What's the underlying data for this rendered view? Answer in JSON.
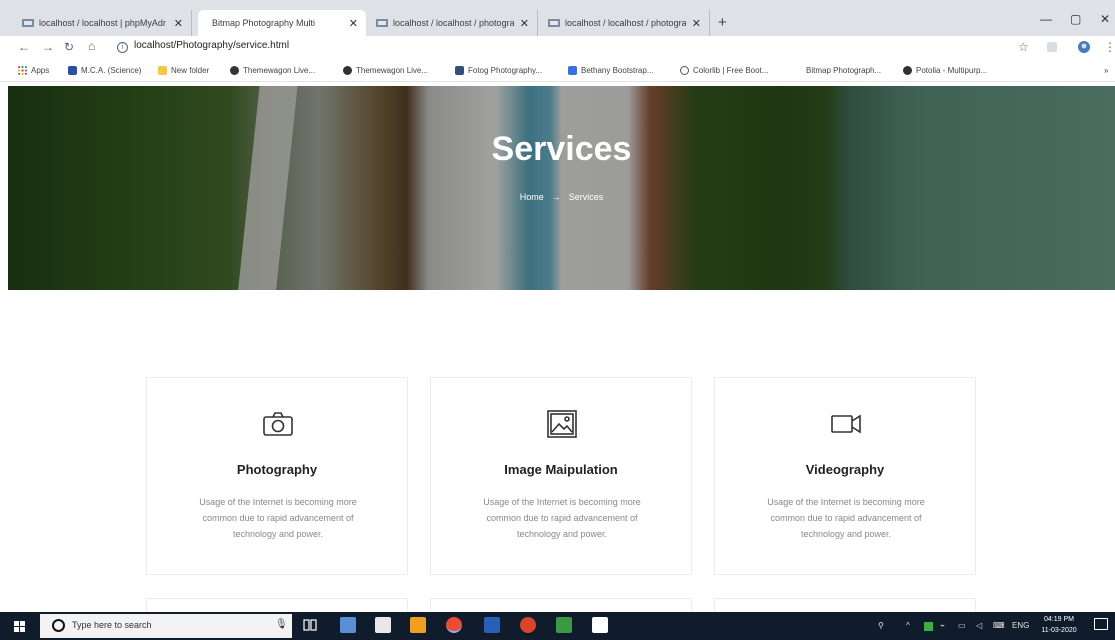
{
  "browser": {
    "tabs": [
      {
        "label": "localhost / localhost | phpMyAdr",
        "active": false
      },
      {
        "label": "Bitmap Photography Multi",
        "active": true
      },
      {
        "label": "localhost / localhost / photogra",
        "active": false
      },
      {
        "label": "localhost / localhost / photogra",
        "active": false
      }
    ],
    "new_tab_label": "+",
    "url": "localhost/Photography/service.html",
    "bookmarks": [
      "Apps",
      "M.C.A. (Science)",
      "New folder",
      "Themewagon Live...",
      "Themewagon Live...",
      "Fotog Photography...",
      "Bethany Bootstrap...",
      "Colorlib | Free Boot...",
      "Bitmap Photograph...",
      "Potolia - Multipurp..."
    ]
  },
  "hero": {
    "title": "Services",
    "breadcrumb": {
      "home": "Home",
      "separator": "→",
      "current": "Services"
    }
  },
  "services": [
    {
      "icon": "camera-icon",
      "title": "Photography",
      "description": "Usage of the Internet is becoming more common due to rapid advancement of technology and power."
    },
    {
      "icon": "image-icon",
      "title": "Image Maipulation",
      "description": "Usage of the Internet is becoming more common due to rapid advancement of technology and power."
    },
    {
      "icon": "video-camera-icon",
      "title": "Videography",
      "description": "Usage of the Internet is becoming more common due to rapid advancement of technology and power."
    }
  ],
  "taskbar": {
    "search_placeholder": "Type here to search",
    "language": "ENG",
    "time": "04:19 PM",
    "date": "11-03-2020"
  },
  "colors": {
    "taskbar": "#101b2b",
    "tab_strip": "#dee1e6",
    "card_border": "#ececec"
  }
}
